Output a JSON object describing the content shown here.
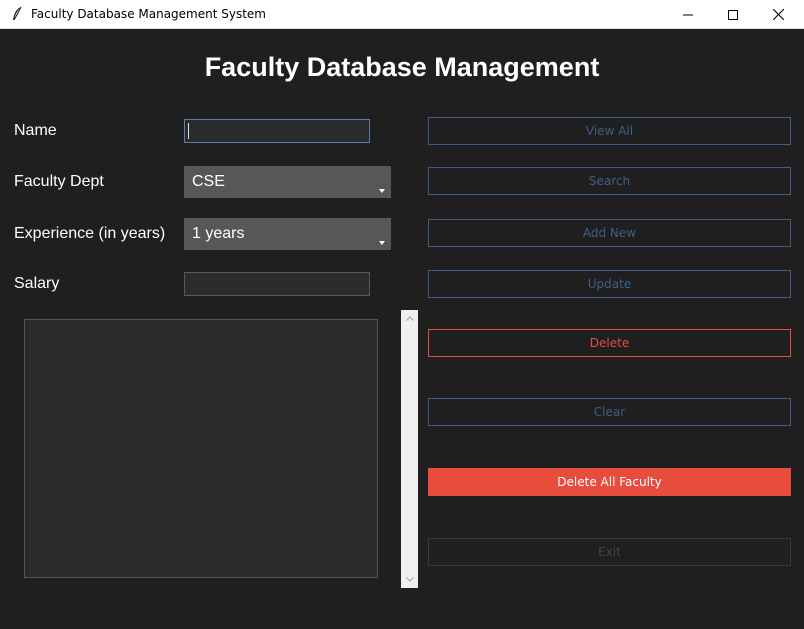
{
  "window": {
    "title": "Faculty Database Management System",
    "icon": "feather-icon"
  },
  "heading": "Faculty Database Management",
  "form": {
    "name_label": "Name",
    "name_value": "",
    "dept_label": "Faculty Dept",
    "dept_value": "CSE",
    "experience_label": "Experience (in years)",
    "experience_value": "1 years",
    "salary_label": "Salary",
    "salary_value": ""
  },
  "buttons": {
    "view_all": "View All",
    "search": "Search",
    "add_new": "Add New",
    "update": "Update",
    "delete": "Delete",
    "clear": "Clear",
    "delete_all": "Delete All Faculty",
    "exit": "Exit"
  },
  "colors": {
    "background": "#1f1f1f",
    "accent_blue": "#3d5f86",
    "danger_red": "#e74c3c"
  }
}
